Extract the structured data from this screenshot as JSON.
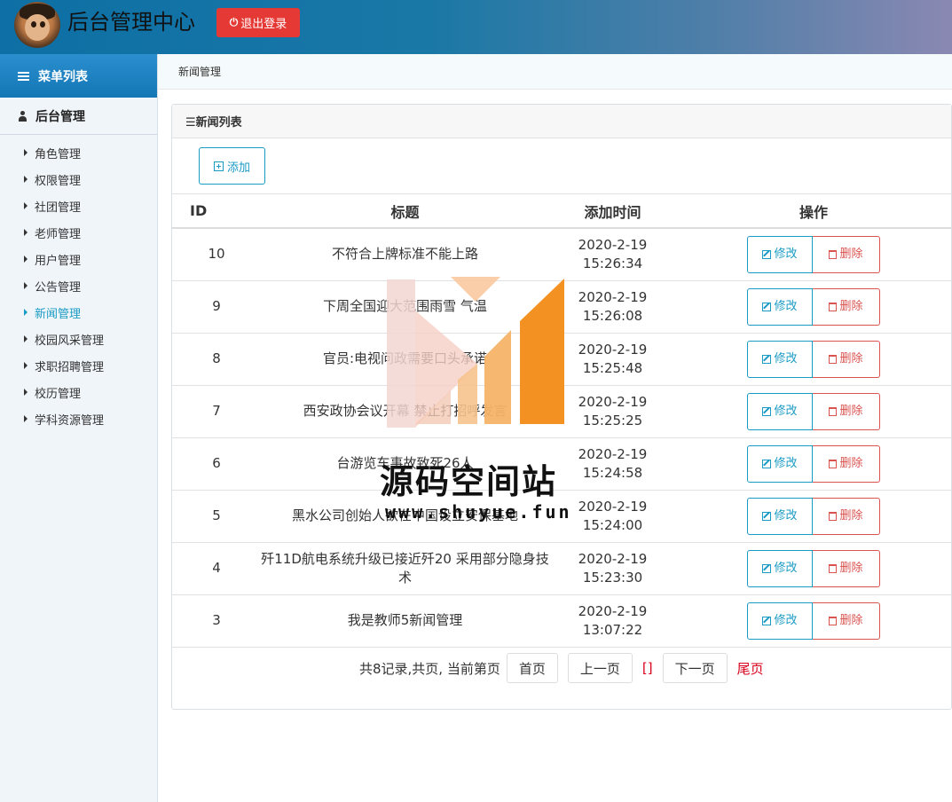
{
  "header": {
    "app_title": "后台管理中心",
    "logout_label": "退出登录",
    "logout_color": "#e53935"
  },
  "sidebar": {
    "head_label": "菜单列表",
    "group_label": "后台管理",
    "items": [
      {
        "label": "角色管理",
        "active": false
      },
      {
        "label": "权限管理",
        "active": false
      },
      {
        "label": "社团管理",
        "active": false
      },
      {
        "label": "老师管理",
        "active": false
      },
      {
        "label": "用户管理",
        "active": false
      },
      {
        "label": "公告管理",
        "active": false
      },
      {
        "label": "新闻管理",
        "active": true
      },
      {
        "label": "校园风采管理",
        "active": false
      },
      {
        "label": "求职招聘管理",
        "active": false
      },
      {
        "label": "校历管理",
        "active": false
      },
      {
        "label": "学科资源管理",
        "active": false
      }
    ]
  },
  "breadcrumb": "新闻管理",
  "panel": {
    "title": "☰新闻列表",
    "add_label": "添加"
  },
  "table": {
    "headers": [
      "ID",
      "标题",
      "添加时间",
      "操作"
    ],
    "edit_label": "修改",
    "delete_label": "删除",
    "rows": [
      {
        "id": "10",
        "title": "不符合上牌标准不能上路",
        "date": "2020-2-19",
        "time": "15:26:34"
      },
      {
        "id": "9",
        "title": "下周全国迎大范围雨雪 气温",
        "date": "2020-2-19",
        "time": "15:26:08"
      },
      {
        "id": "8",
        "title": "官员:电视问政需要口头承诺",
        "date": "2020-2-19",
        "time": "15:25:48"
      },
      {
        "id": "7",
        "title": "西安政协会议开幕 禁止打招呼发言",
        "date": "2020-2-19",
        "time": "15:25:25"
      },
      {
        "id": "6",
        "title": "台游览车事故致死26人",
        "date": "2020-2-19",
        "time": "15:24:58"
      },
      {
        "id": "5",
        "title": "黑水公司创始人欲在中国设立安保基地",
        "date": "2020-2-19",
        "time": "15:24:00"
      },
      {
        "id": "4",
        "title": "歼11D航电系统升级已接近歼20 采用部分隐身技术",
        "date": "2020-2-19",
        "time": "15:23:30"
      },
      {
        "id": "3",
        "title": "我是教师5新闻管理",
        "date": "2020-2-19",
        "time": "13:07:22"
      }
    ]
  },
  "pager": {
    "summary": "共8记录,共页, 当前第页",
    "first": "首页",
    "prev": "上一页",
    "current": "[]",
    "next": "下一页",
    "last": "尾页"
  },
  "watermark": {
    "text": "源码空间站",
    "url": "www.shuyue.fun"
  }
}
